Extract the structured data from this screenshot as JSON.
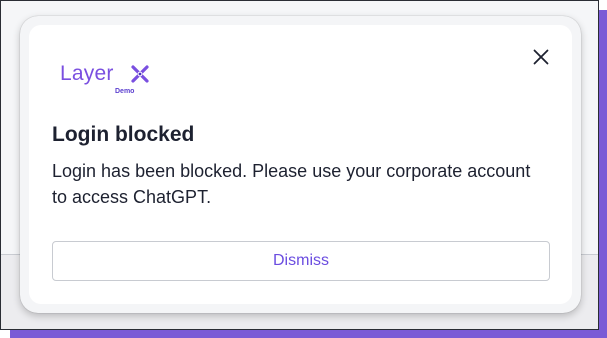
{
  "brand": {
    "name": "Layer",
    "mark_icon": "x-mark-icon",
    "subtitle": "Demo",
    "color": "#7a4fe0"
  },
  "dialog": {
    "title": "Login blocked",
    "message": "Login has been blocked. Please use your corporate account to access ChatGPT.",
    "dismiss_label": "Dismiss",
    "close_icon": "close-icon"
  },
  "colors": {
    "accent": "#6b4de0",
    "accent_shadow": "#7a5bd6",
    "text": "#1d2130"
  }
}
